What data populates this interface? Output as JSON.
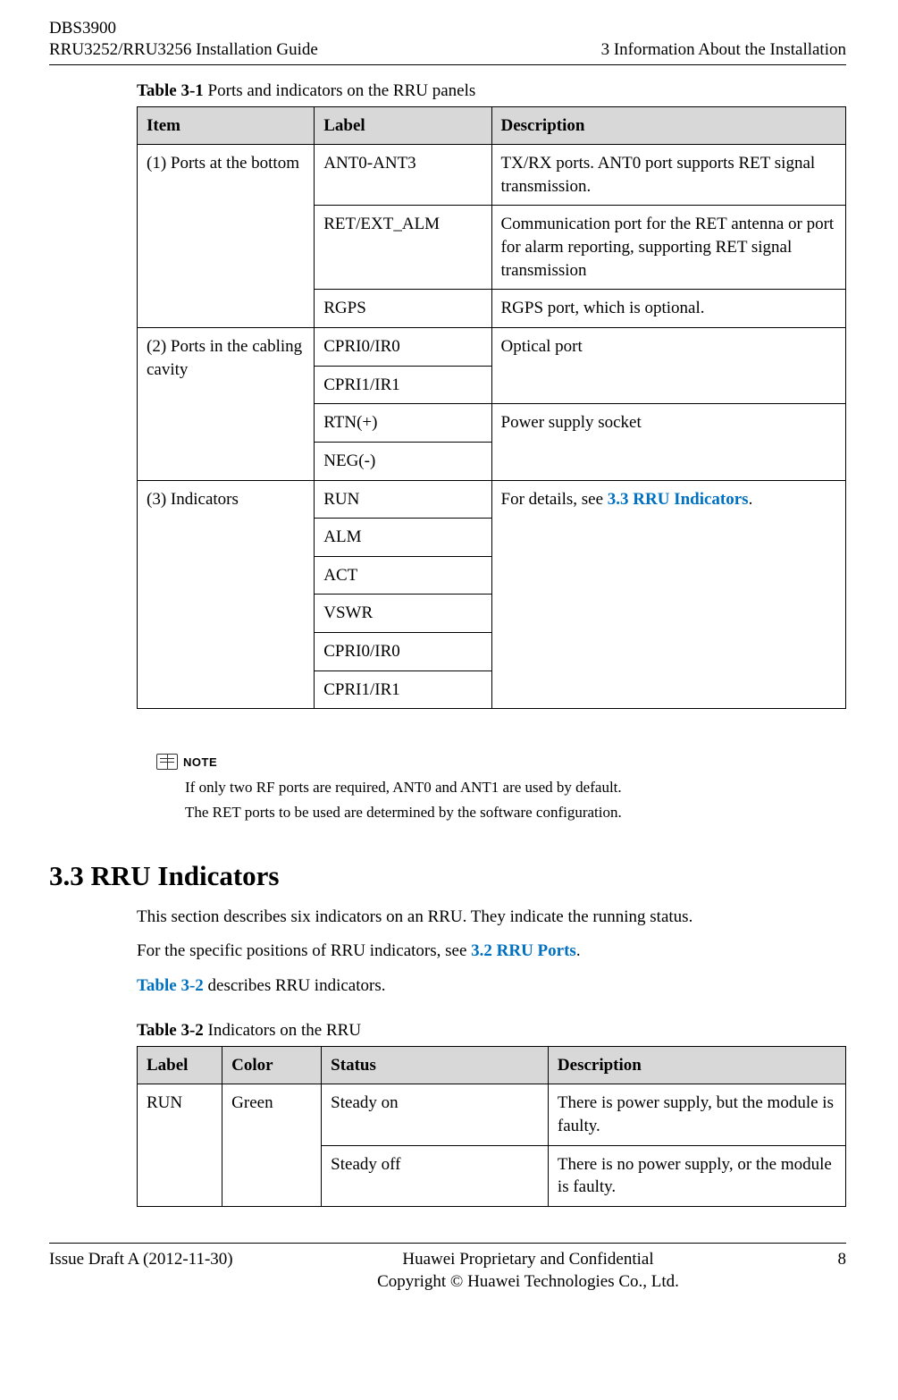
{
  "header": {
    "left_line1": "DBS3900",
    "left_line2": "RRU3252/RRU3256 Installation Guide",
    "right": "3 Information About the Installation"
  },
  "table31": {
    "caption_bold": "Table 3-1",
    "caption_rest": " Ports and indicators on the RRU panels",
    "headers": {
      "c1": "Item",
      "c2": "Label",
      "c3": "Description"
    },
    "rows": {
      "r1": {
        "item": "(1) Ports at the bottom",
        "label": "ANT0-ANT3",
        "desc": "TX/RX ports. ANT0 port supports RET signal transmission."
      },
      "r2": {
        "label": "RET/EXT_ALM",
        "desc": "Communication port for the RET antenna or port for alarm reporting, supporting RET signal transmission"
      },
      "r3": {
        "label": "RGPS",
        "desc": "RGPS port, which is optional."
      },
      "r4": {
        "item": "(2) Ports in the cabling cavity",
        "label": "CPRI0/IR0",
        "desc": "Optical port"
      },
      "r5": {
        "label": "CPRI1/IR1"
      },
      "r6": {
        "label": "RTN(+)",
        "desc": "Power supply socket"
      },
      "r7": {
        "label": "NEG(-)"
      },
      "r8": {
        "item": "(3) Indicators",
        "label": "RUN",
        "desc_prefix": "For details, see ",
        "desc_link": "3.3 RRU Indicators",
        "desc_suffix": "."
      },
      "r9": {
        "label": "ALM"
      },
      "r10": {
        "label": "ACT"
      },
      "r11": {
        "label": "VSWR"
      },
      "r12": {
        "label": "CPRI0/IR0"
      },
      "r13": {
        "label": "CPRI1/IR1"
      }
    }
  },
  "note": {
    "label": "NOTE",
    "line1": "If only two RF ports are required, ANT0 and ANT1 are used by default.",
    "line2": "The RET ports to be used are determined by the software configuration."
  },
  "section33": {
    "heading": "3.3 RRU Indicators",
    "para1": "This section describes six indicators on an RRU. They indicate the running status.",
    "para2_prefix": "For the specific positions of RRU indicators, see ",
    "para2_link": "3.2 RRU Ports",
    "para2_suffix": ".",
    "para3_link": "Table 3-2",
    "para3_suffix": " describes RRU indicators."
  },
  "table32": {
    "caption_bold": "Table 3-2",
    "caption_rest": " Indicators on the RRU",
    "headers": {
      "c1": "Label",
      "c2": "Color",
      "c3": "Status",
      "c4": "Description"
    },
    "rows": {
      "r1": {
        "label": "RUN",
        "color": "Green",
        "status": "Steady on",
        "desc": "There is power supply, but the module is faulty."
      },
      "r2": {
        "status": "Steady off",
        "desc": "There is no power supply, or the module is faulty."
      }
    }
  },
  "footer": {
    "left": "Issue Draft A (2012-11-30)",
    "center_line1": "Huawei Proprietary and Confidential",
    "center_line2": "Copyright © Huawei Technologies Co., Ltd.",
    "right": "8"
  }
}
